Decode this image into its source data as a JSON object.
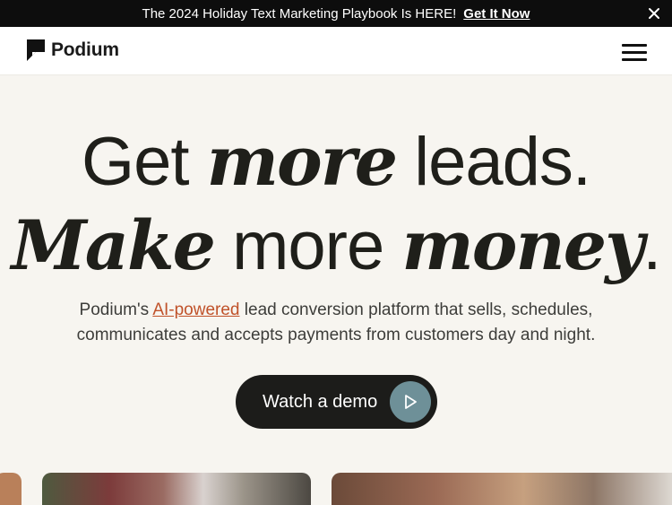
{
  "announcement": {
    "message": "The 2024 Holiday Text Marketing Playbook Is HERE!",
    "link": "Get It Now",
    "close_icon": "close-icon"
  },
  "nav": {
    "brand": "Podium",
    "logo_icon": "podium-logo-icon",
    "menu_icon": "hamburger-menu-icon"
  },
  "hero": {
    "line1_a": "Get ",
    "line1_b": "more",
    "line1_c": " leads.",
    "line2_a": "Make",
    "line2_b": " more ",
    "line2_c": "money",
    "line2_d": ".",
    "sub_a": "Podium's ",
    "sub_link": "AI-powered",
    "sub_b": " lead conversion platform that sells, schedules, communicates and accepts payments from customers day and night.",
    "cta": "Watch a demo",
    "cta_icon": "play-icon"
  },
  "colors": {
    "background": "#f7f5f0",
    "bar": "#0d0d0d",
    "link_accent": "#c0522a",
    "cta_bg": "#1c1c1a",
    "play_bg": "#6e9098"
  }
}
